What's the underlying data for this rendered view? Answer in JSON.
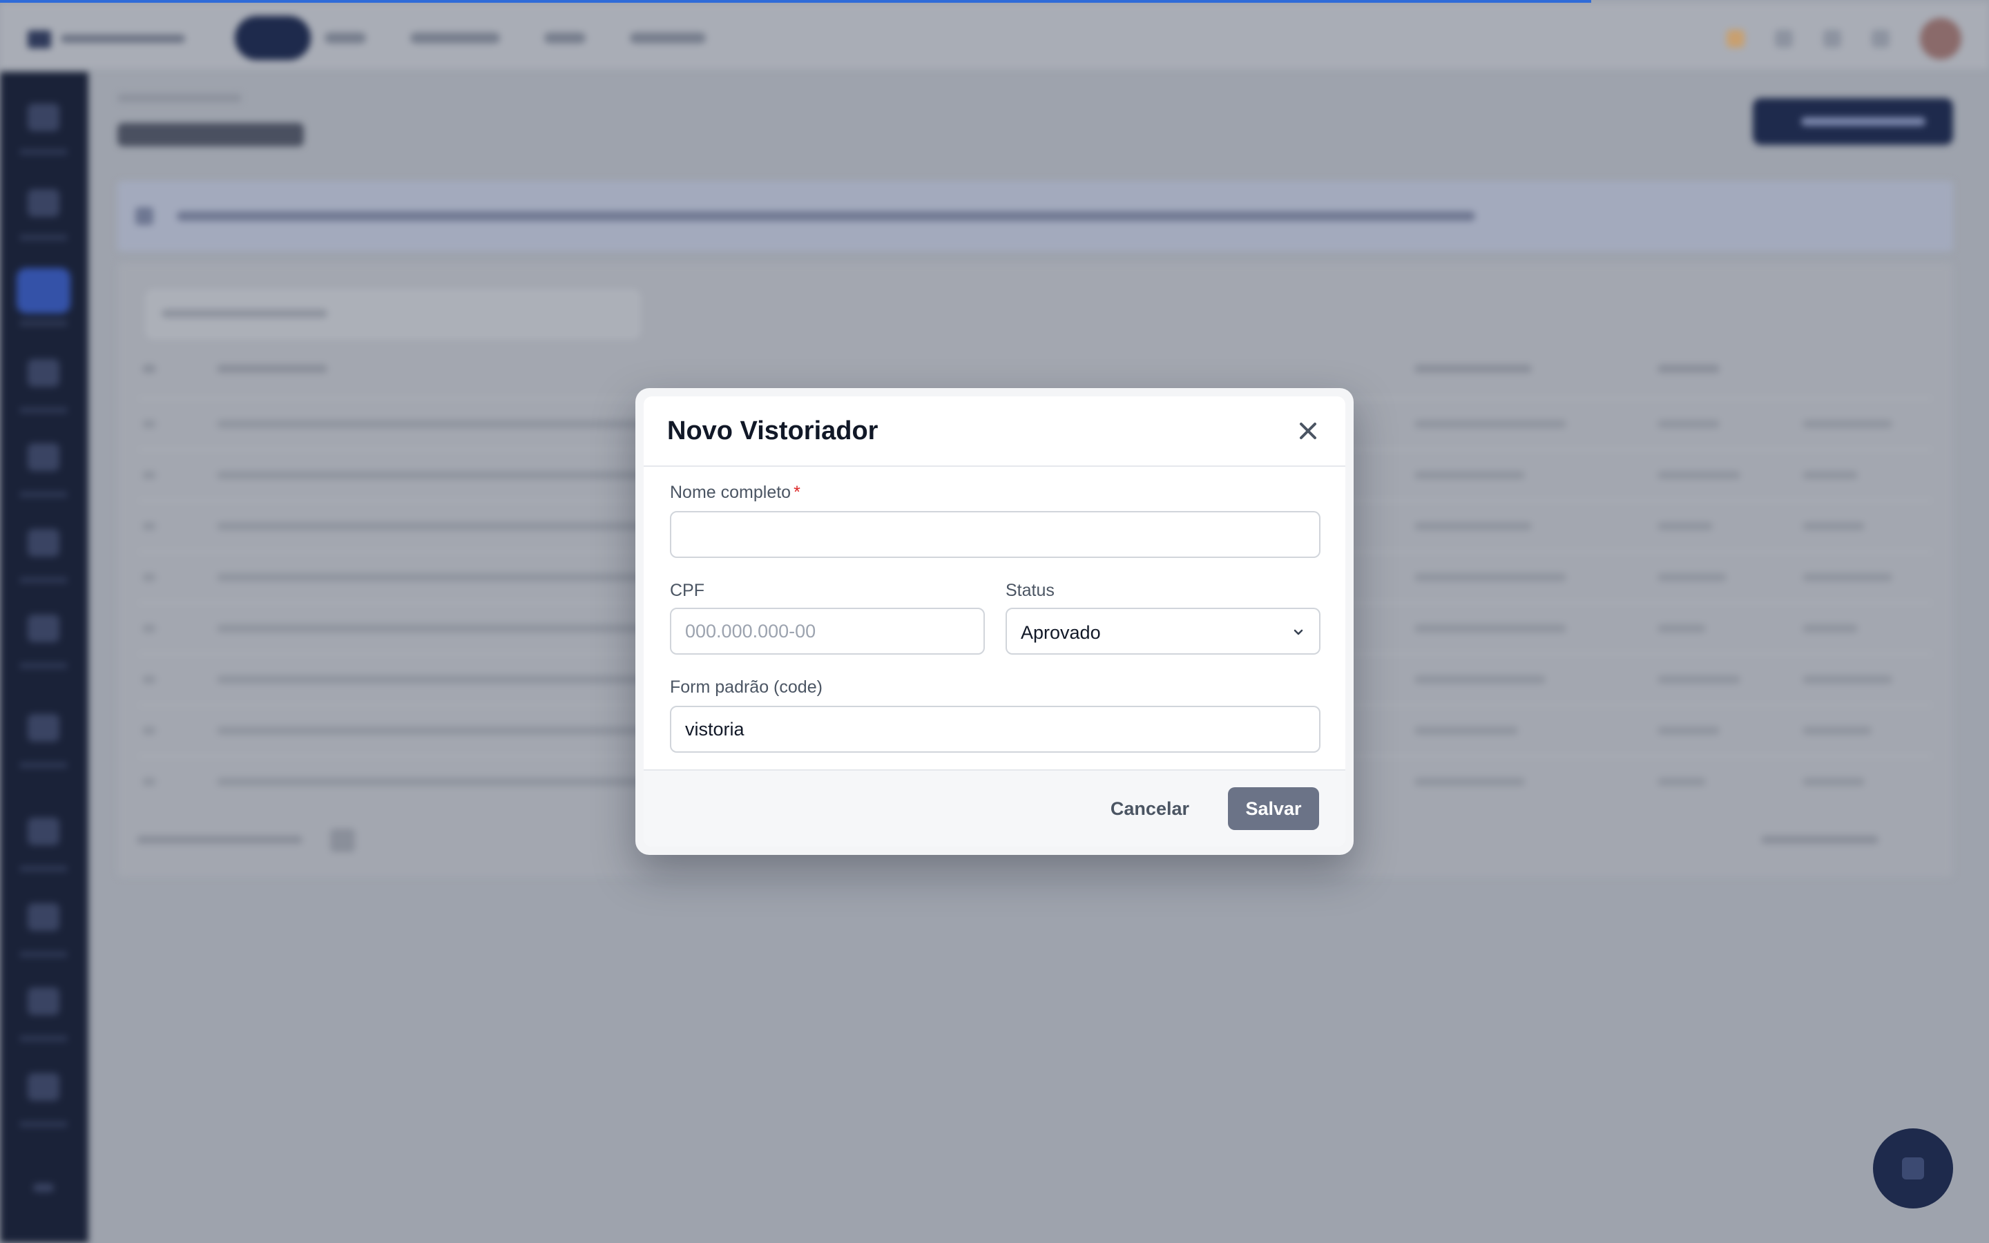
{
  "modal": {
    "title": "Novo Vistoriador",
    "fields": {
      "nome": {
        "label": "Nome completo",
        "required_mark": "*",
        "value": ""
      },
      "cpf": {
        "label": "CPF",
        "value": "",
        "placeholder": "000.000.000-00"
      },
      "status": {
        "label": "Status",
        "selected": "Aprovado"
      },
      "form": {
        "label": "Form padrão (code)",
        "value": "vistoria"
      }
    },
    "buttons": {
      "cancel": "Cancelar",
      "save": "Salvar"
    }
  },
  "icons": {
    "close": "close-icon",
    "chevron": "chevron-down-icon"
  },
  "colors": {
    "accent": "#2f6bd8",
    "sidebar": "#1a2238",
    "primary_dark": "#1e2a4c",
    "save_button": "#6b7387",
    "required": "#dc2626"
  }
}
